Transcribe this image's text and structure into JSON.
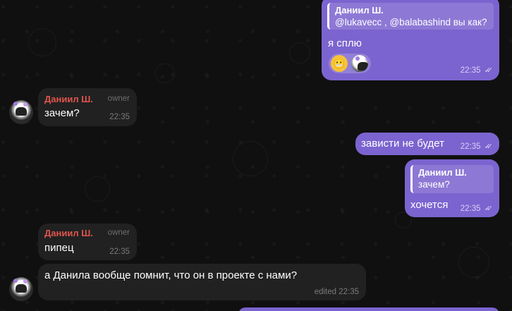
{
  "messages": [
    {
      "id": "m1",
      "direction": "out",
      "reply": {
        "name": "Даниил Ш.",
        "text": "@lukavecc , @balabashind вы как?"
      },
      "text": "я сплю",
      "time": "22:35",
      "reactions": [
        "grinning-face-emoji",
        "avatar-reaction"
      ]
    },
    {
      "id": "m2",
      "direction": "in",
      "sender": "Даниил Ш.",
      "role": "owner",
      "text": "зачем?",
      "time": "22:35"
    },
    {
      "id": "m3",
      "direction": "out",
      "text": "зависти не будет",
      "time": "22:35"
    },
    {
      "id": "m4",
      "direction": "out",
      "reply": {
        "name": "Даниил Ш.",
        "text": "зачем?"
      },
      "text": "хочется",
      "time": "22:35"
    },
    {
      "id": "m5",
      "direction": "in",
      "sender": "Даниил Ш.",
      "role": "owner",
      "text": "пипец",
      "time": "22:35"
    },
    {
      "id": "m6",
      "direction": "in",
      "text": "а Данила вообще помнит, что он в проекте с нами?",
      "time": "edited 22:35"
    }
  ],
  "colors": {
    "outgoing": "#7b64cf",
    "incoming": "#212121",
    "sender_name": "#e0554d",
    "background": "#0f0f0f"
  }
}
